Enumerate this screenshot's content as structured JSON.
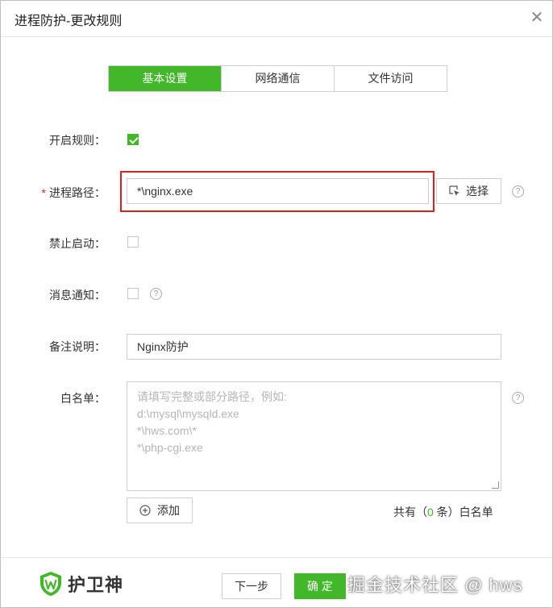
{
  "dialog": {
    "title": "进程防护-更改规则",
    "close": "✕"
  },
  "tabs": [
    {
      "label": "基本设置",
      "active": true
    },
    {
      "label": "网络通信",
      "active": false
    },
    {
      "label": "文件访问",
      "active": false
    }
  ],
  "form": {
    "enable_rule": {
      "label": "开启规则：",
      "checked": true
    },
    "process_path": {
      "required_mark": "*",
      "label": "进程路径：",
      "value": "*\\nginx.exe",
      "select_label": "选择"
    },
    "forbid_start": {
      "label": "禁止启动：",
      "checked": false
    },
    "notify": {
      "label": "消息通知：",
      "checked": false
    },
    "remark": {
      "label": "备注说明：",
      "value": "Nginx防护"
    },
    "whitelist": {
      "label": "白名单：",
      "placeholder_lines": [
        "请填写完整或部分路径，例如:",
        "d:\\mysql\\mysqld.exe",
        "*\\hws.com\\*",
        "*\\php-cgi.exe"
      ],
      "add_label": "添加",
      "count_prefix": "共有（",
      "count": "0",
      "count_suffix": " 条）白名单"
    }
  },
  "footer": {
    "brand": "护卫神",
    "prev_label": "下一步",
    "confirm_label": "确 定",
    "watermark": "掘金技术社区 @ hws"
  },
  "colors": {
    "accent": "#42b72a",
    "highlight": "#d9201b"
  },
  "icons": {
    "help": "question-circle-icon",
    "select": "cursor-select-icon",
    "add": "plus-circle-icon",
    "brand": "shield-w-icon"
  }
}
